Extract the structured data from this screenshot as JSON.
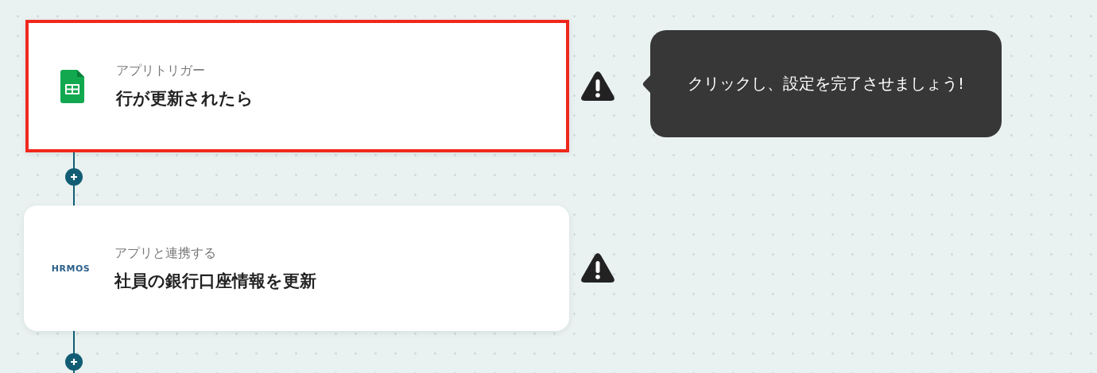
{
  "steps": [
    {
      "kind": "sheets",
      "label": "アプリトリガー",
      "title": "行が更新されたら",
      "selected": true,
      "warning": true,
      "tooltip": "クリックし、設定を完了させましょう!"
    },
    {
      "kind": "hrmos",
      "logo_text": "HRMOS",
      "label": "アプリと連携する",
      "title": "社員の銀行口座情報を更新",
      "selected": false,
      "warning": true
    }
  ]
}
